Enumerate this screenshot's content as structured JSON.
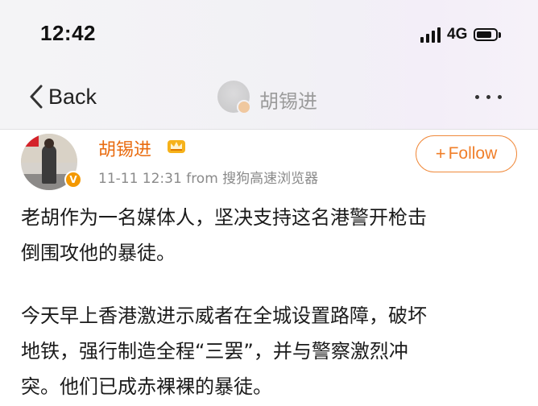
{
  "status_bar": {
    "time": "12:42",
    "network": "4G",
    "signal_bars": 4,
    "battery_level": 0.8
  },
  "nav": {
    "back_label": "Back",
    "title": "胡锡进"
  },
  "post": {
    "author": "胡锡进",
    "timestamp": "11-11 12:31",
    "source": "from 搜狗高速浏览器",
    "verified": true,
    "follow": {
      "plus": "+",
      "label": "Follow"
    },
    "paragraph_1": "老胡作为一名媒体人，坚决支持这名港警开枪击\n倒围攻他的暴徒。",
    "paragraph_2": "今天早上香港激进示威者在全城设置路障，破坏\n地铁，强行制造全程“三罢”，并与警察激烈冲\n突。他们已成赤裸裸的暴徒。"
  },
  "colors": {
    "accent": "#f07f2a",
    "author": "#e96b0f",
    "meta": "#8a8a8a",
    "verified_badge": "#f39800"
  },
  "icons": {
    "back": "chevron-left-icon",
    "more": "more-dots-icon",
    "member": "member-crown-icon",
    "verified": "verified-v-icon"
  }
}
